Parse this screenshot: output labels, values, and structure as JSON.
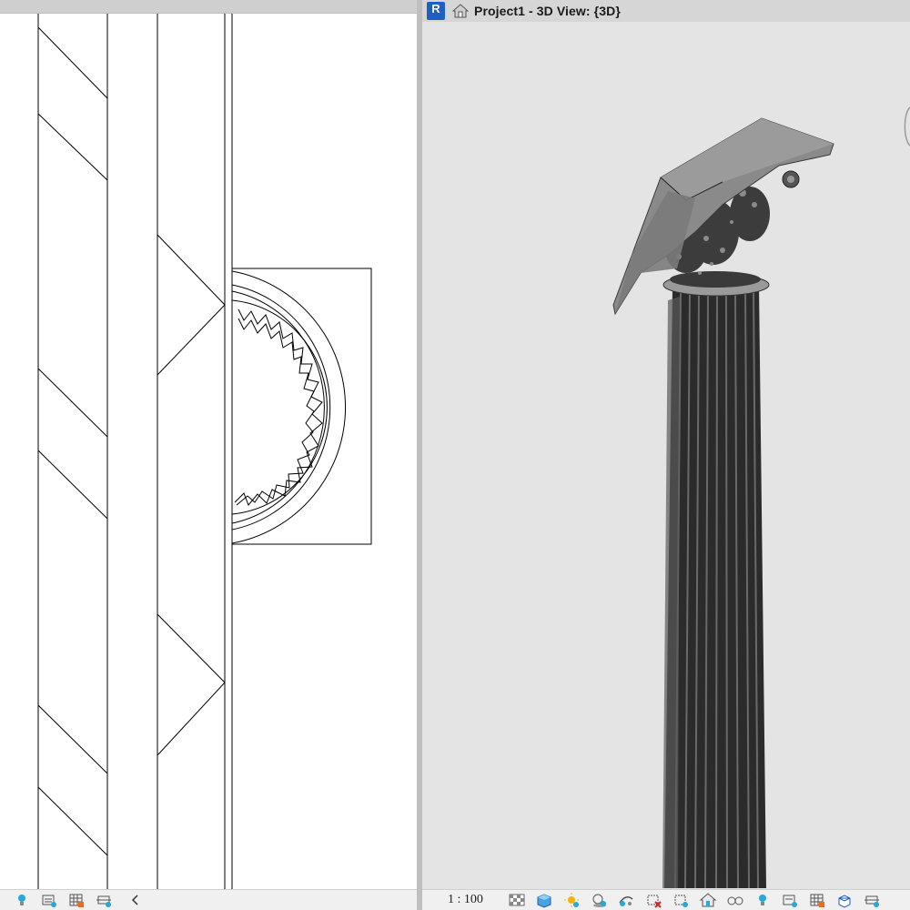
{
  "colors": {
    "viewport_bg": "#e4e4e4",
    "plan_bg": "#ffffff",
    "column_dark": "#2b2b2b",
    "capital_gray": "#8a8a8a",
    "brand_blue": "#1f5fc2"
  },
  "app": {
    "logo_letter": "R"
  },
  "right_view": {
    "title": "Project1 - 3D View: {3D}",
    "scale_label": "1 : 100"
  },
  "left_statusbar": {
    "icons": [
      "bulb-icon",
      "detail-level-icon",
      "visual-style-icon",
      "crop-region-icon",
      "scroll-left-icon"
    ]
  },
  "right_statusbar": {
    "icons": [
      "detail-level-icon",
      "visual-style-icon",
      "sun-path-icon",
      "shadows-icon",
      "rendering-icon",
      "crop-view-icon",
      "hide-crop-icon",
      "lock-view-icon",
      "temp-hide-icon",
      "reveal-hidden-icon",
      "bulb-icon",
      "analytical-model-icon",
      "highlight-displacement-icon",
      "reveal-constraints-icon",
      "worksharing-icon"
    ]
  }
}
